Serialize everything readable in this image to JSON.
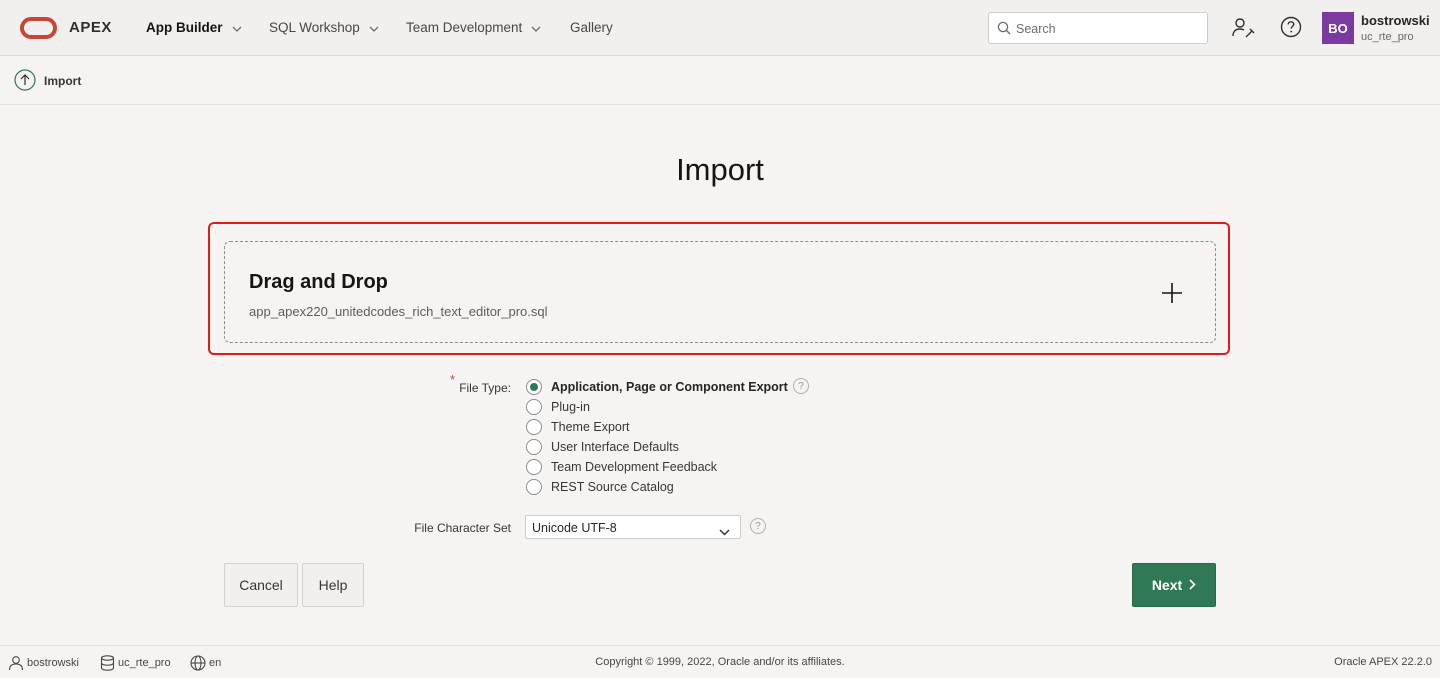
{
  "header": {
    "brand": "APEX",
    "nav": [
      {
        "label": "App Builder",
        "active": true,
        "has_dropdown": true
      },
      {
        "label": "SQL Workshop",
        "active": false,
        "has_dropdown": true
      },
      {
        "label": "Team Development",
        "active": false,
        "has_dropdown": true
      },
      {
        "label": "Gallery",
        "active": false,
        "has_dropdown": false
      }
    ],
    "search_placeholder": "Search",
    "user": {
      "initials": "BO",
      "name": "bostrowski",
      "workspace": "uc_rte_pro"
    },
    "colors": {
      "logo": "#c74634",
      "avatar": "#7b3aa0"
    }
  },
  "breadcrumb": {
    "label": "Import",
    "icon": "upload-arrow-icon"
  },
  "main": {
    "title": "Import",
    "dropzone": {
      "title": "Drag and Drop",
      "filename": "app_apex220_unitedcodes_rich_text_editor_pro.sql"
    },
    "file_type": {
      "label": "File Type:",
      "required_marker": "*",
      "options": [
        {
          "label": "Application, Page or Component Export",
          "checked": true
        },
        {
          "label": "Plug-in",
          "checked": false
        },
        {
          "label": "Theme Export",
          "checked": false
        },
        {
          "label": "User Interface Defaults",
          "checked": false
        },
        {
          "label": "Team Development Feedback",
          "checked": false
        },
        {
          "label": "REST Source Catalog",
          "checked": false
        }
      ]
    },
    "charset": {
      "label": "File Character Set",
      "value": "Unicode UTF-8"
    },
    "help_symbol": "?",
    "buttons": {
      "cancel": "Cancel",
      "help": "Help",
      "next": "Next"
    },
    "colors": {
      "primary": "#2f7a55",
      "highlight": "#e01b1b"
    }
  },
  "footer": {
    "user": "bostrowski",
    "workspace": "uc_rte_pro",
    "language": "en",
    "copyright": "Copyright © 1999, 2022, Oracle and/or its affiliates.",
    "version": "Oracle APEX 22.2.0"
  }
}
